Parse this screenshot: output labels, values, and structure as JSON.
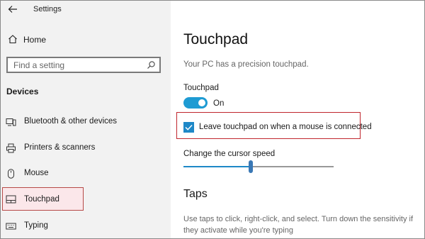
{
  "app": {
    "title": "Settings"
  },
  "sidebar": {
    "home_label": "Home",
    "search_placeholder": "Find a setting",
    "section_title": "Devices",
    "items": [
      {
        "label": "Bluetooth & other devices",
        "icon": "bluetooth-icon"
      },
      {
        "label": "Printers & scanners",
        "icon": "printer-icon"
      },
      {
        "label": "Mouse",
        "icon": "mouse-icon"
      },
      {
        "label": "Touchpad",
        "icon": "touchpad-icon",
        "selected": true
      },
      {
        "label": "Typing",
        "icon": "keyboard-icon"
      }
    ]
  },
  "main": {
    "title": "Touchpad",
    "precision_text": "Your PC has a precision touchpad.",
    "touchpad_toggle": {
      "label": "Touchpad",
      "state": "On",
      "on": true
    },
    "leave_on_checkbox": {
      "label": "Leave touchpad on when a mouse is connected",
      "checked": true
    },
    "cursor_speed": {
      "label": "Change the cursor speed",
      "value_fraction": 0.45
    },
    "taps": {
      "title": "Taps",
      "description": "Use taps to click, right-click, and select. Turn down the sensitivity if they activate while you're typing"
    }
  },
  "colors": {
    "accent": "#1e88c7",
    "highlight_border": "#c0262d",
    "sidebar_bg": "#f2f2f2"
  }
}
